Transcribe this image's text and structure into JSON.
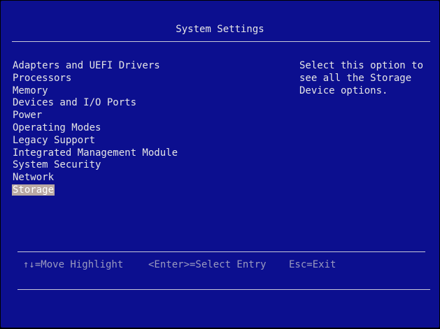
{
  "header": {
    "title": "System Settings"
  },
  "menu": {
    "items": [
      {
        "label": "Adapters and UEFI Drivers"
      },
      {
        "label": "Processors"
      },
      {
        "label": "Memory"
      },
      {
        "label": "Devices and I/O Ports"
      },
      {
        "label": "Power"
      },
      {
        "label": "Operating Modes"
      },
      {
        "label": "Legacy Support"
      },
      {
        "label": "Integrated Management Module"
      },
      {
        "label": "System Security"
      },
      {
        "label": "Network"
      },
      {
        "label": "Storage"
      }
    ],
    "selected_label": "Storage"
  },
  "help": {
    "lines": [
      "Select this option to",
      "see all the Storage",
      "Device options."
    ]
  },
  "footer": {
    "move": "↑↓=Move Highlight",
    "select": "<Enter>=Select Entry",
    "exit": "Esc=Exit"
  },
  "colors": {
    "background": "#0c0f8f",
    "text": "#e6e6e6",
    "highlight": "#b9a9a4",
    "footer_text": "#9a9ac0"
  }
}
